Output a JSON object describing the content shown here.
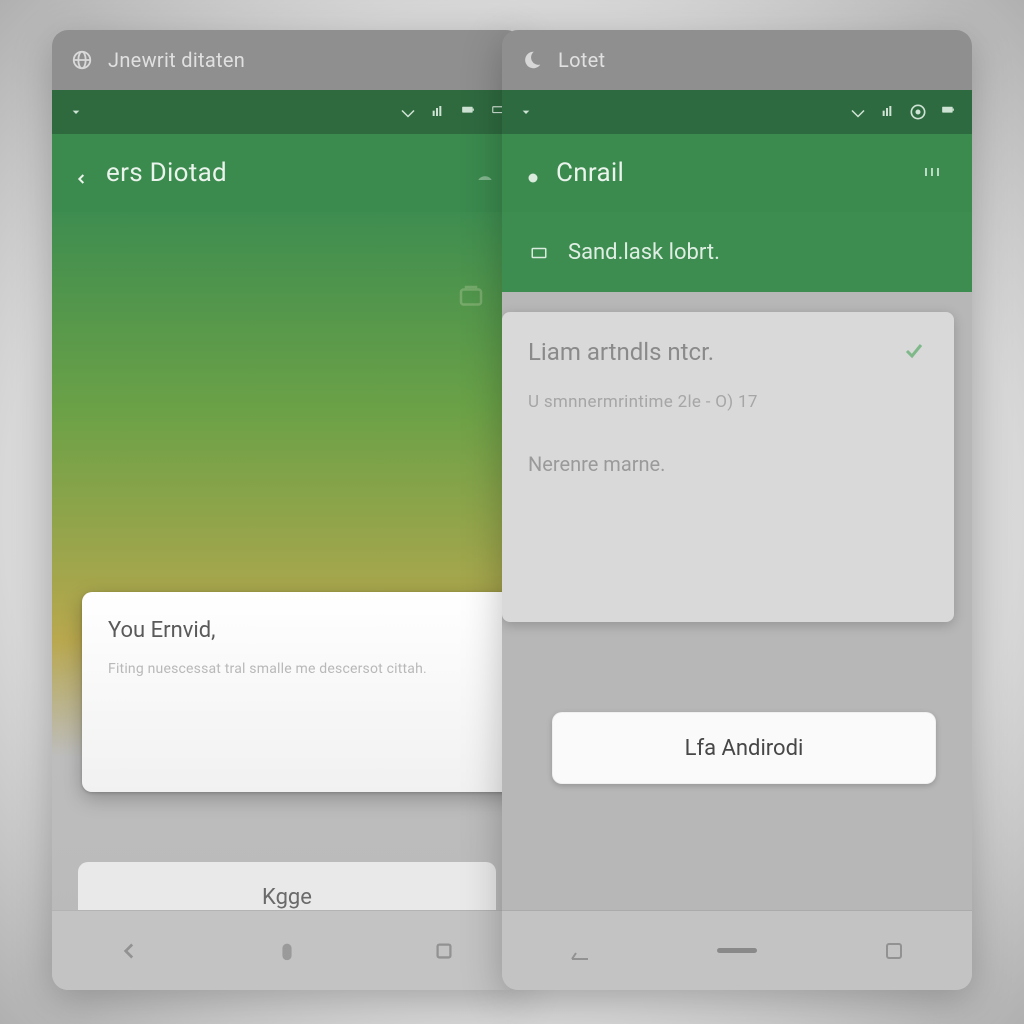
{
  "left": {
    "chrome_title": "Jnewrit ditaten",
    "action_title": "ers Diotad",
    "card_title": "You Ernvid,",
    "card_body": "Fiting nuescessat tral smalle me descersot cittah.",
    "button_label": "Kgge"
  },
  "right": {
    "chrome_title": "Lotet",
    "action_title": "Cnrail",
    "sub_label": "Sand.lask lobrt.",
    "card_title": "Liam artndls ntcr.",
    "card_meta": "U smnnermrintime   2le  - O) 17",
    "card_meta2": "Nerenre marne.",
    "button_label": "Lfa Andirodi"
  }
}
